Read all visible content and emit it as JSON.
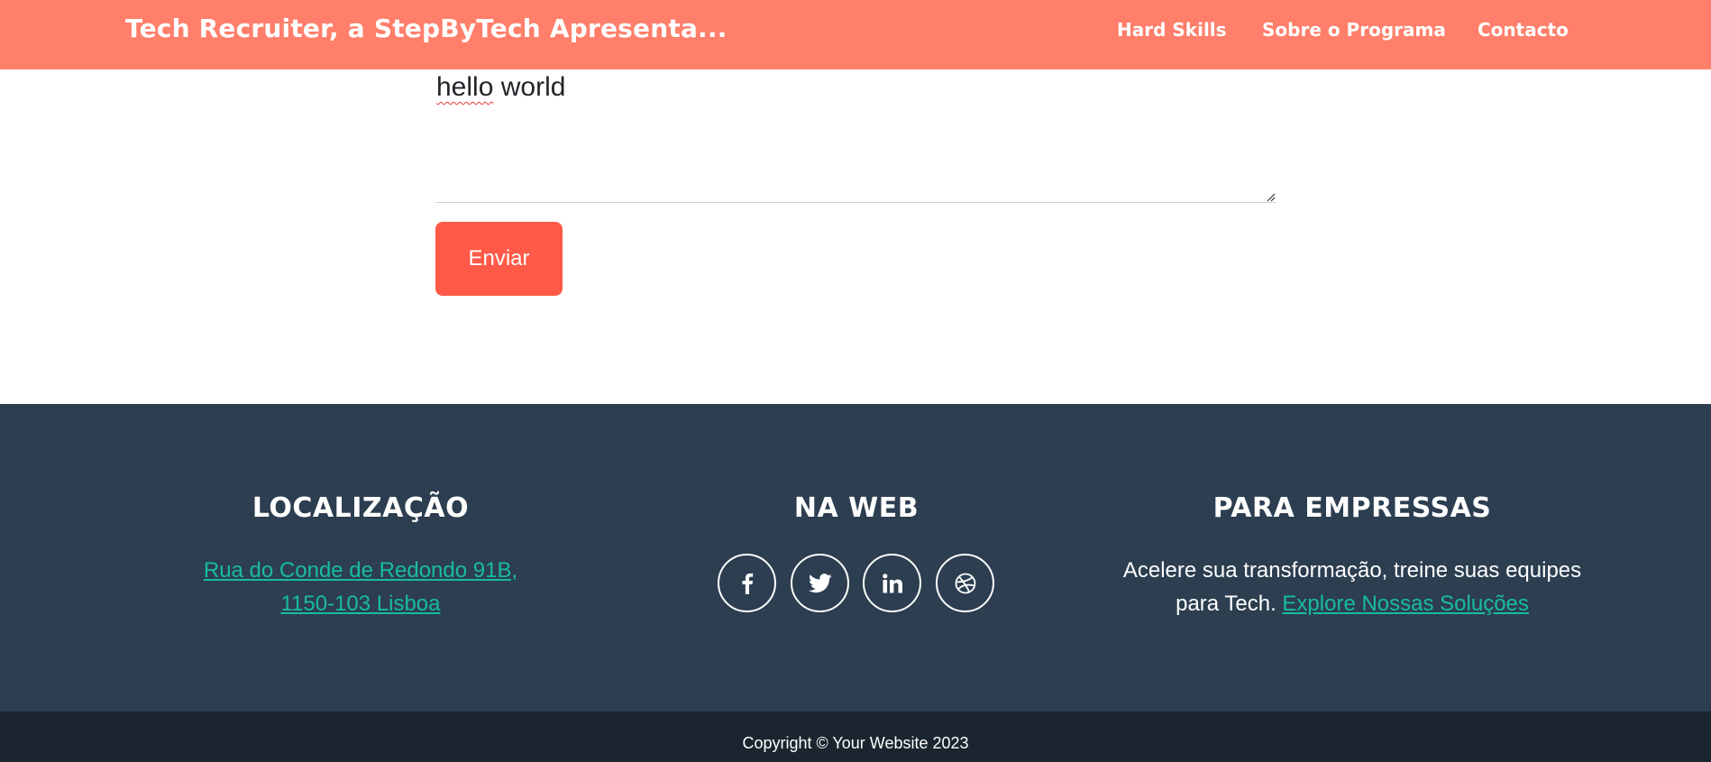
{
  "navbar": {
    "brand": "Tech Recruiter, a StepByTech Apresenta...",
    "links": [
      "Hard Skills",
      "Sobre o Programa",
      "Contacto"
    ]
  },
  "form": {
    "message_value_underlined": "hello",
    "message_value_rest": " world",
    "submit_label": "Enviar"
  },
  "footer": {
    "location": {
      "title": "LOCALIZAÇÃO",
      "address_line1": "Rua do Conde de Redondo 91B,",
      "address_line2": "1150-103 Lisboa"
    },
    "web": {
      "title": "NA WEB",
      "icons": [
        "facebook-icon",
        "twitter-icon",
        "linkedin-icon",
        "dribbble-icon"
      ]
    },
    "companies": {
      "title": "PARA EMPRESSAS",
      "text_line1": "Acelere sua transformação, treine suas equipes",
      "text_prefix": "para Tech.",
      "link": "Explore Nossas Soluções"
    }
  },
  "copyright": "Copyright © Your Website 2023",
  "colors": {
    "navbar": "#ff7f6b",
    "button": "#ff5a47",
    "footer": "#2c3e50",
    "copyright_bar": "#1a252f",
    "link": "#18bc9c"
  }
}
